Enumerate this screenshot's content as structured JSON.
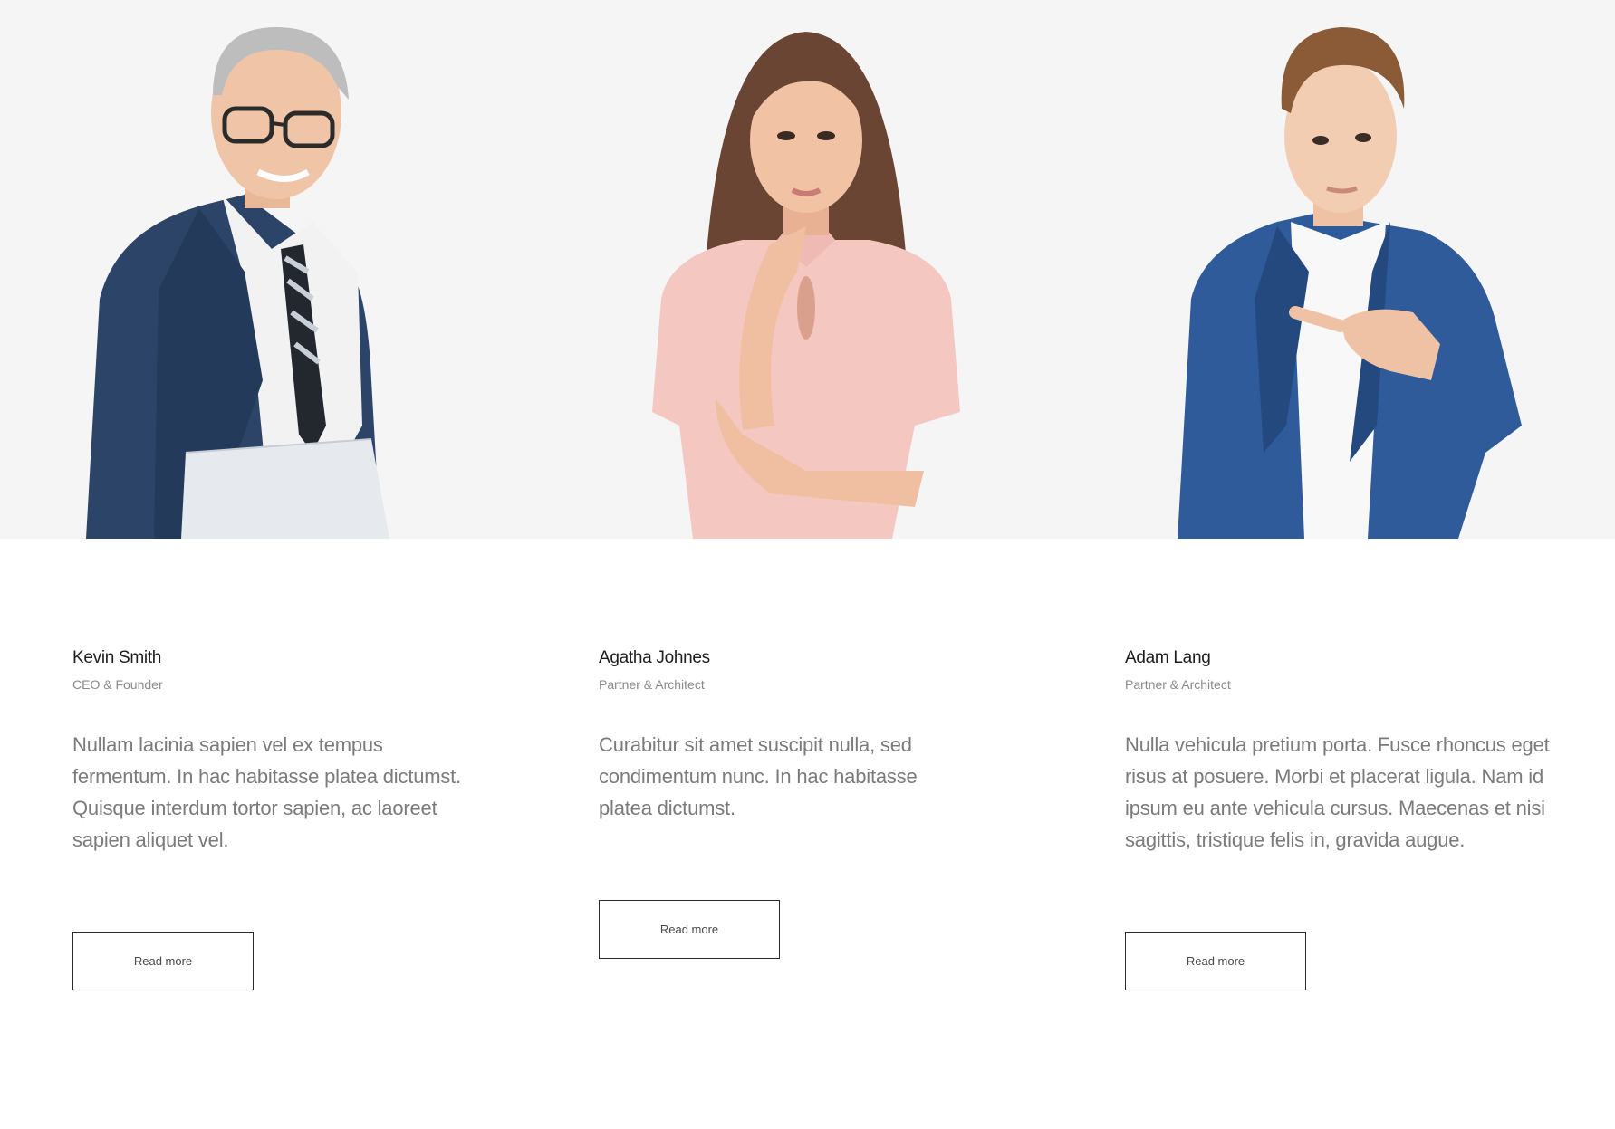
{
  "team": {
    "members": [
      {
        "name": "Kevin Smith",
        "role": "CEO & Founder",
        "bio": "Nullam lacinia sapien vel ex tempus fermentum. In hac habitasse platea dictumst. Quisque interdum tortor sapien, ac laoreet sapien aliquet vel.",
        "button_label": "Read more"
      },
      {
        "name": "Agatha Johnes",
        "role": "Partner & Architect",
        "bio": "Curabitur sit amet suscipit nulla, sed condimentum nunc. In hac habitasse platea dictumst.",
        "button_label": "Read more"
      },
      {
        "name": "Adam Lang",
        "role": "Partner & Architect",
        "bio": "Nulla vehicula pretium porta. Fusce rhoncus eget risus at posuere. Morbi et placerat ligula. Nam id ipsum eu ante vehicula cursus. Maecenas et nisi sagittis, tristique felis in, gravida augue.",
        "button_label": "Read more"
      }
    ]
  },
  "colors": {
    "photo_background": "#f5f5f5",
    "name_text": "#1e1e1e",
    "role_text": "#8a8a8a",
    "bio_text": "#7b7b7b",
    "button_border": "#2a2a2a"
  }
}
